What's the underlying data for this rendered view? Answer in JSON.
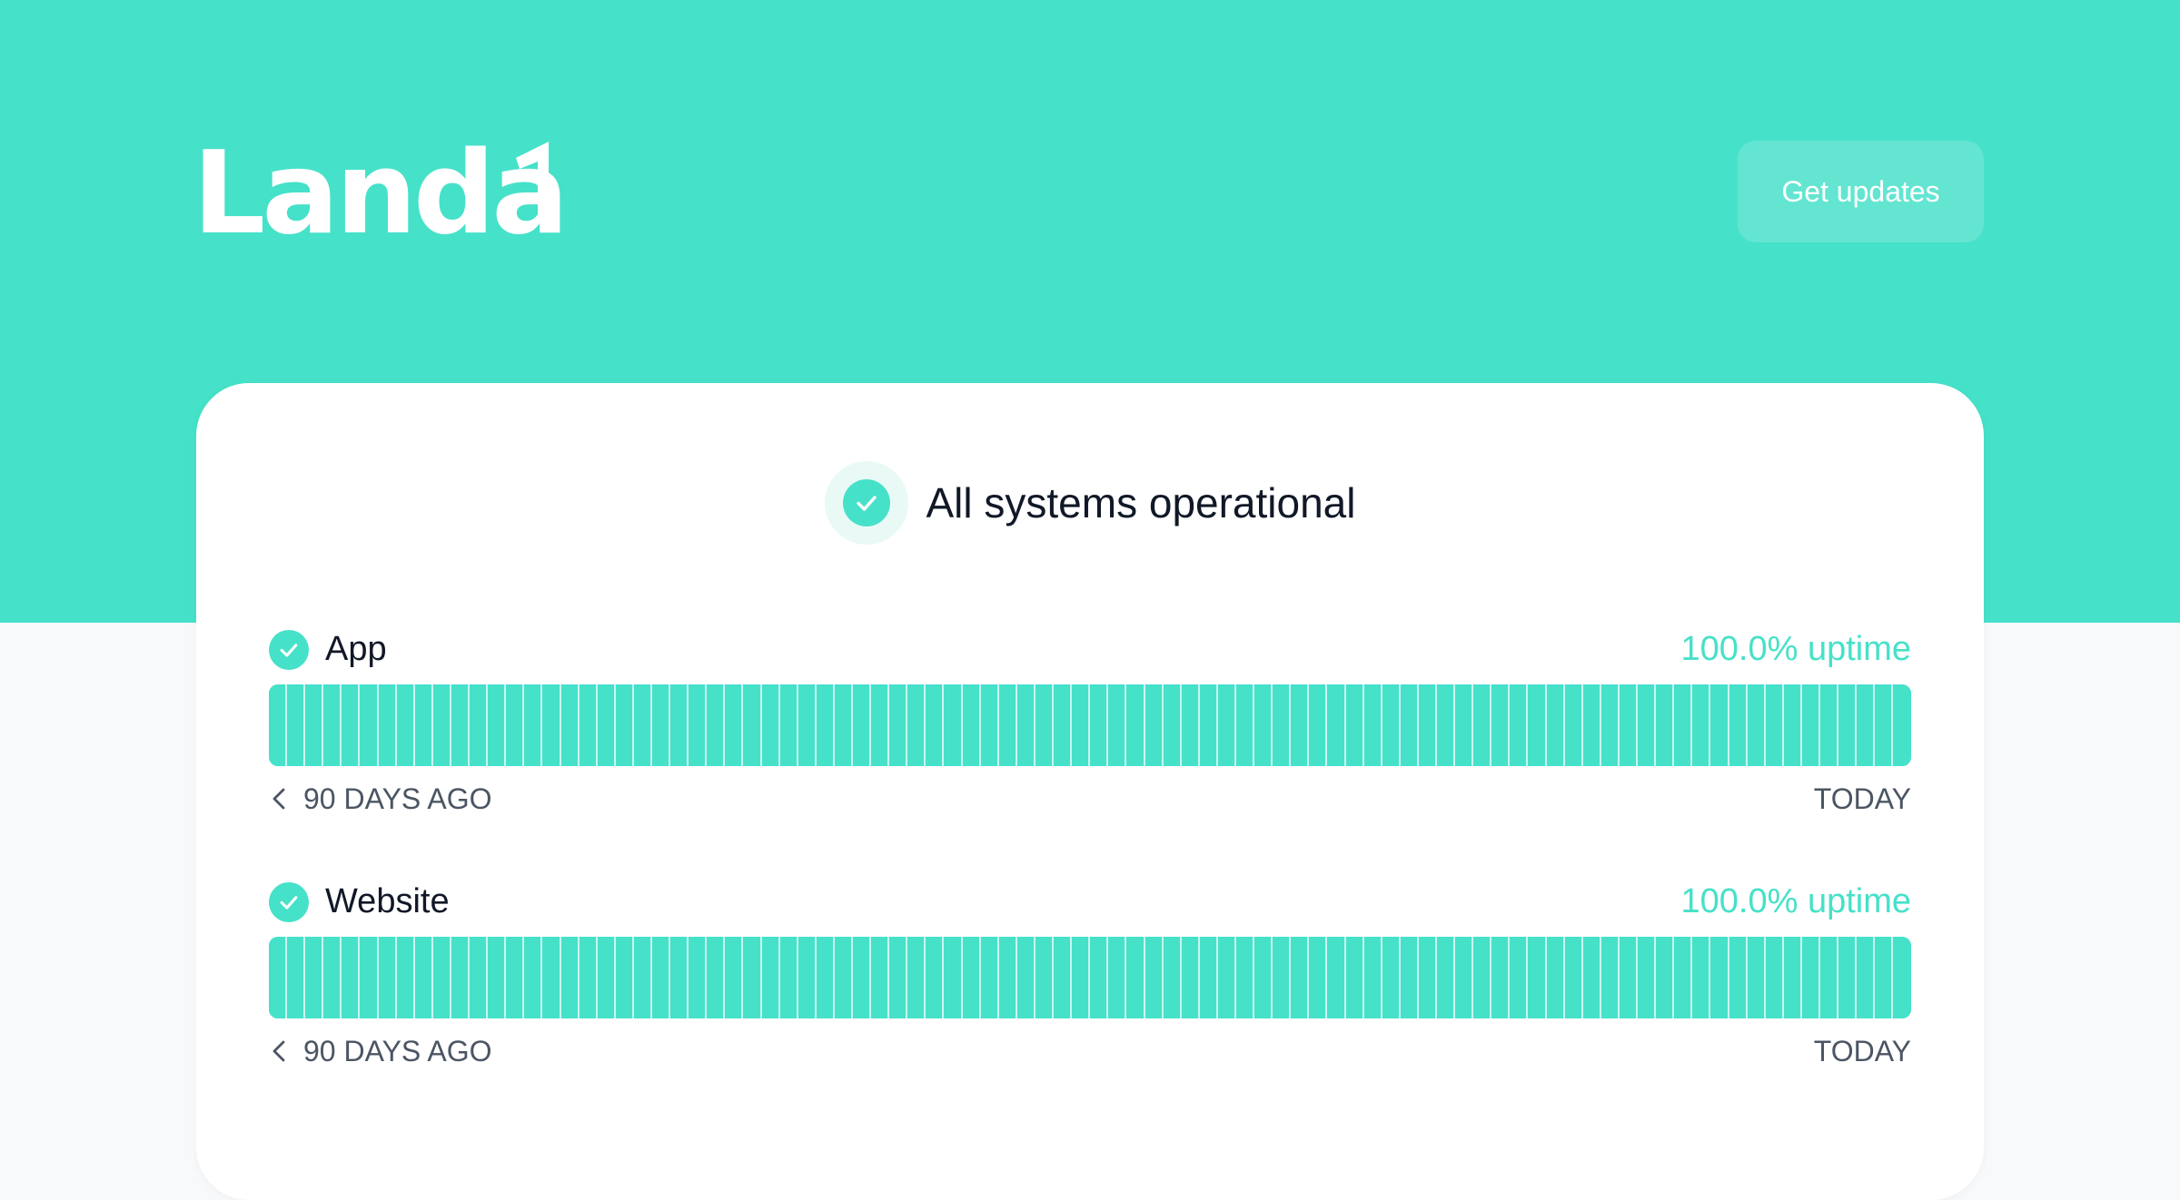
{
  "brand": {
    "logo_text": "Landa",
    "accent_color": "#46e1c9"
  },
  "header": {
    "get_updates_label": "Get updates"
  },
  "overall_status": {
    "text": "All systems operational",
    "icon": "check-circle-icon"
  },
  "components": [
    {
      "name": "App",
      "uptime_text": "100.0% uptime",
      "days": 90,
      "status": "operational",
      "range_start_label": "90 DAYS AGO",
      "range_end_label": "TODAY"
    },
    {
      "name": "Website",
      "uptime_text": "100.0% uptime",
      "days": 90,
      "status": "operational",
      "range_start_label": "90 DAYS AGO",
      "range_end_label": "TODAY"
    }
  ]
}
